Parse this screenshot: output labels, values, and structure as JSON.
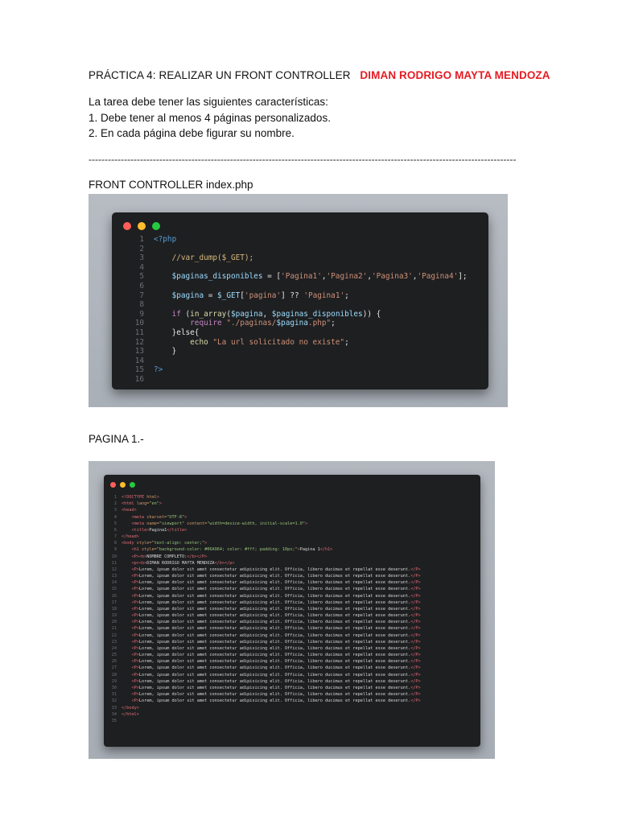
{
  "doc": {
    "title_prefix": "PRÁCTICA 4: REALIZAR UN FRONT CONTROLLER",
    "author": "DIMAN RODRIGO MAYTA MENDOZA",
    "task_lines": [
      "La tarea debe tener las siguientes características:",
      "1. Debe tener al menos 4 páginas personalizados.",
      "2. En cada página debe figurar su nombre."
    ],
    "divider": "-------------------------------------------------------------------------------------------------------------------------------------",
    "section1_label": "FRONT CONTROLLER index.php",
    "section2_label": "PAGINA 1.-"
  },
  "colors": {
    "author": "#e51c23",
    "editor_bg": "#1e1f21",
    "php_tag": "#569cd6",
    "comment": "#d7ba7d",
    "variable": "#9cdcfe",
    "string": "#ce9178",
    "keyword": "#c586c0",
    "function": "#dcdcaa",
    "html_tag": "#e06c75",
    "attr": "#d19a66",
    "attr_value": "#98c379"
  },
  "code1": {
    "lines": [
      [
        {
          "t": "<?php",
          "c": "php_tag"
        }
      ],
      [],
      [
        {
          "t": "    //var_dump($_GET);",
          "c": "comment"
        }
      ],
      [],
      [
        {
          "t": "    $paginas_disponibles",
          "c": "variable"
        },
        {
          "t": " = [",
          "c": "plain"
        },
        {
          "t": "'Pagina1'",
          "c": "string"
        },
        {
          "t": ",",
          "c": "plain"
        },
        {
          "t": "'Pagina2'",
          "c": "string"
        },
        {
          "t": ",",
          "c": "plain"
        },
        {
          "t": "'Pagina3'",
          "c": "string"
        },
        {
          "t": ",",
          "c": "plain"
        },
        {
          "t": "'Pagina4'",
          "c": "string"
        },
        {
          "t": "];",
          "c": "plain"
        }
      ],
      [],
      [
        {
          "t": "    $pagina",
          "c": "variable"
        },
        {
          "t": " = ",
          "c": "plain"
        },
        {
          "t": "$_GET",
          "c": "variable"
        },
        {
          "t": "[",
          "c": "plain"
        },
        {
          "t": "'pagina'",
          "c": "string"
        },
        {
          "t": "] ?? ",
          "c": "plain"
        },
        {
          "t": "'Pagina1'",
          "c": "string"
        },
        {
          "t": ";",
          "c": "plain"
        }
      ],
      [],
      [
        {
          "t": "    if ",
          "c": "keyword"
        },
        {
          "t": "(",
          "c": "plain"
        },
        {
          "t": "in_array",
          "c": "function"
        },
        {
          "t": "(",
          "c": "plain"
        },
        {
          "t": "$pagina",
          "c": "variable"
        },
        {
          "t": ", ",
          "c": "plain"
        },
        {
          "t": "$paginas_disponibles",
          "c": "variable"
        },
        {
          "t": ")) {",
          "c": "plain"
        }
      ],
      [
        {
          "t": "        require ",
          "c": "keyword"
        },
        {
          "t": "\"./paginas/",
          "c": "string"
        },
        {
          "t": "$pagina",
          "c": "variable"
        },
        {
          "t": ".php\"",
          "c": "string"
        },
        {
          "t": ";",
          "c": "plain"
        }
      ],
      [
        {
          "t": "    }else{",
          "c": "plain"
        }
      ],
      [
        {
          "t": "        echo ",
          "c": "function"
        },
        {
          "t": "\"La url solicitado no existe\"",
          "c": "string"
        },
        {
          "t": ";",
          "c": "plain"
        }
      ],
      [
        {
          "t": "    }",
          "c": "plain"
        }
      ],
      [],
      [
        {
          "t": "?>",
          "c": "php_tag"
        }
      ],
      []
    ]
  },
  "code2": {
    "lines": [
      [
        {
          "t": "<!DOCTYPE ",
          "c": "html_tag"
        },
        {
          "t": "html",
          "c": "attr"
        },
        {
          "t": ">",
          "c": "html_tag"
        }
      ],
      [
        {
          "t": "<html ",
          "c": "html_tag"
        },
        {
          "t": "lang=",
          "c": "attr"
        },
        {
          "t": "\"en\"",
          "c": "attr_value"
        },
        {
          "t": ">",
          "c": "html_tag"
        }
      ],
      [
        {
          "t": "<head>",
          "c": "html_tag"
        }
      ],
      [
        {
          "t": "    <meta ",
          "c": "html_tag"
        },
        {
          "t": "charset=",
          "c": "attr"
        },
        {
          "t": "\"UTF-8\"",
          "c": "attr_value"
        },
        {
          "t": ">",
          "c": "html_tag"
        }
      ],
      [
        {
          "t": "    <meta ",
          "c": "html_tag"
        },
        {
          "t": "name=",
          "c": "attr"
        },
        {
          "t": "\"viewport\" ",
          "c": "attr_value"
        },
        {
          "t": "content=",
          "c": "attr"
        },
        {
          "t": "\"width=device-width, initial-scale=1.0\"",
          "c": "attr_value"
        },
        {
          "t": ">",
          "c": "html_tag"
        }
      ],
      [
        {
          "t": "    <title>",
          "c": "html_tag"
        },
        {
          "t": "Pagina1",
          "c": "plain"
        },
        {
          "t": "</title>",
          "c": "html_tag"
        }
      ],
      [
        {
          "t": "</head>",
          "c": "html_tag"
        }
      ],
      [
        {
          "t": "<body ",
          "c": "html_tag"
        },
        {
          "t": "style=",
          "c": "attr"
        },
        {
          "t": "\"text-align: center;\"",
          "c": "attr_value"
        },
        {
          "t": ">",
          "c": "html_tag"
        }
      ],
      [
        {
          "t": "    <h1 ",
          "c": "html_tag"
        },
        {
          "t": "style=",
          "c": "attr"
        },
        {
          "t": "\"background-color: #06A964; color: #fff; padding: 10px;\"",
          "c": "attr_value"
        },
        {
          "t": ">",
          "c": "html_tag"
        },
        {
          "t": "Pagina 1",
          "c": "plain"
        },
        {
          "t": "</h1>",
          "c": "html_tag"
        }
      ],
      [
        {
          "t": "    <P><b>",
          "c": "html_tag"
        },
        {
          "t": "NOMBRE COMPLETO:",
          "c": "plain"
        },
        {
          "t": "</b></P>",
          "c": "html_tag"
        }
      ],
      [
        {
          "t": "    <p><b>",
          "c": "html_tag"
        },
        {
          "t": "DIMAN RODRIGO MAYTA MENDOZA",
          "c": "plain"
        },
        {
          "t": "</b></p>",
          "c": "html_tag"
        }
      ],
      [
        {
          "t": "    <P>",
          "c": "html_tag"
        },
        {
          "t": "Lorem, ipsum dolor sit amet consectetur adipisicing elit. Officia, libero ducimus et repellat esse deserunt.",
          "c": "plain"
        },
        {
          "t": "</P>",
          "c": "html_tag"
        }
      ],
      [
        {
          "t": "    <P>",
          "c": "html_tag"
        },
        {
          "t": "Lorem, ipsum dolor sit amet consectetur adipisicing elit. Officia, libero ducimus et repellat esse deserunt.",
          "c": "plain"
        },
        {
          "t": "</P>",
          "c": "html_tag"
        }
      ],
      [
        {
          "t": "    <P>",
          "c": "html_tag"
        },
        {
          "t": "Lorem, ipsum dolor sit amet consectetur adipisicing elit. Officia, libero ducimus et repellat esse deserunt.",
          "c": "plain"
        },
        {
          "t": "</P>",
          "c": "html_tag"
        }
      ],
      [
        {
          "t": "    <P>",
          "c": "html_tag"
        },
        {
          "t": "Lorem, ipsum dolor sit amet consectetur adipisicing elit. Officia, libero ducimus et repellat esse deserunt.",
          "c": "plain"
        },
        {
          "t": "</P>",
          "c": "html_tag"
        }
      ],
      [
        {
          "t": "    <P>",
          "c": "html_tag"
        },
        {
          "t": "Lorem, ipsum dolor sit amet consectetur adipisicing elit. Officia, libero ducimus et repellat esse deserunt.",
          "c": "plain"
        },
        {
          "t": "</P>",
          "c": "html_tag"
        }
      ],
      [
        {
          "t": "    <P>",
          "c": "html_tag"
        },
        {
          "t": "Lorem, ipsum dolor sit amet consectetur adipisicing elit. Officia, libero ducimus et repellat esse deserunt.",
          "c": "plain"
        },
        {
          "t": "</P>",
          "c": "html_tag"
        }
      ],
      [
        {
          "t": "    <P>",
          "c": "html_tag"
        },
        {
          "t": "Lorem, ipsum dolor sit amet consectetur adipisicing elit. Officia, libero ducimus et repellat esse deserunt.",
          "c": "plain"
        },
        {
          "t": "</P>",
          "c": "html_tag"
        }
      ],
      [
        {
          "t": "    <P>",
          "c": "html_tag"
        },
        {
          "t": "Lorem, ipsum dolor sit amet consectetur adipisicing elit. Officia, libero ducimus et repellat esse deserunt.",
          "c": "plain"
        },
        {
          "t": "</P>",
          "c": "html_tag"
        }
      ],
      [
        {
          "t": "    <P>",
          "c": "html_tag"
        },
        {
          "t": "Lorem, ipsum dolor sit amet consectetur adipisicing elit. Officia, libero ducimus et repellat esse deserunt.",
          "c": "plain"
        },
        {
          "t": "</P>",
          "c": "html_tag"
        }
      ],
      [
        {
          "t": "    <P>",
          "c": "html_tag"
        },
        {
          "t": "Lorem, ipsum dolor sit amet consectetur adipisicing elit. Officia, libero ducimus et repellat esse deserunt.",
          "c": "plain"
        },
        {
          "t": "</P>",
          "c": "html_tag"
        }
      ],
      [
        {
          "t": "    <P>",
          "c": "html_tag"
        },
        {
          "t": "Lorem, ipsum dolor sit amet consectetur adipisicing elit. Officia, libero ducimus et repellat esse deserunt.",
          "c": "plain"
        },
        {
          "t": "</P>",
          "c": "html_tag"
        }
      ],
      [
        {
          "t": "    <P>",
          "c": "html_tag"
        },
        {
          "t": "Lorem, ipsum dolor sit amet consectetur adipisicing elit. Officia, libero ducimus et repellat esse deserunt.",
          "c": "plain"
        },
        {
          "t": "</P>",
          "c": "html_tag"
        }
      ],
      [
        {
          "t": "    <P>",
          "c": "html_tag"
        },
        {
          "t": "Lorem, ipsum dolor sit amet consectetur adipisicing elit. Officia, libero ducimus et repellat esse deserunt.",
          "c": "plain"
        },
        {
          "t": "</P>",
          "c": "html_tag"
        }
      ],
      [
        {
          "t": "    <P>",
          "c": "html_tag"
        },
        {
          "t": "Lorem, ipsum dolor sit amet consectetur adipisicing elit. Officia, libero ducimus et repellat esse deserunt.",
          "c": "plain"
        },
        {
          "t": "</P>",
          "c": "html_tag"
        }
      ],
      [
        {
          "t": "    <P>",
          "c": "html_tag"
        },
        {
          "t": "Lorem, ipsum dolor sit amet consectetur adipisicing elit. Officia, libero ducimus et repellat esse deserunt.",
          "c": "plain"
        },
        {
          "t": "</P>",
          "c": "html_tag"
        }
      ],
      [
        {
          "t": "    <P>",
          "c": "html_tag"
        },
        {
          "t": "Lorem, ipsum dolor sit amet consectetur adipisicing elit. Officia, libero ducimus et repellat esse deserunt.",
          "c": "plain"
        },
        {
          "t": "</P>",
          "c": "html_tag"
        }
      ],
      [
        {
          "t": "    <P>",
          "c": "html_tag"
        },
        {
          "t": "Lorem, ipsum dolor sit amet consectetur adipisicing elit. Officia, libero ducimus et repellat esse deserunt.",
          "c": "plain"
        },
        {
          "t": "</P>",
          "c": "html_tag"
        }
      ],
      [
        {
          "t": "    <P>",
          "c": "html_tag"
        },
        {
          "t": "Lorem, ipsum dolor sit amet consectetur adipisicing elit. Officia, libero ducimus et repellat esse deserunt.",
          "c": "plain"
        },
        {
          "t": "</P>",
          "c": "html_tag"
        }
      ],
      [
        {
          "t": "    <P>",
          "c": "html_tag"
        },
        {
          "t": "Lorem, ipsum dolor sit amet consectetur adipisicing elit. Officia, libero ducimus et repellat esse deserunt.",
          "c": "plain"
        },
        {
          "t": "</P>",
          "c": "html_tag"
        }
      ],
      [
        {
          "t": "    <P>",
          "c": "html_tag"
        },
        {
          "t": "Lorem, ipsum dolor sit amet consectetur adipisicing elit. Officia, libero ducimus et repellat esse deserunt.",
          "c": "plain"
        },
        {
          "t": "</P>",
          "c": "html_tag"
        }
      ],
      [
        {
          "t": "    <P>",
          "c": "html_tag"
        },
        {
          "t": "Lorem, ipsum dolor sit amet consectetur adipisicing elit. Officia, libero ducimus et repellat esse deserunt.",
          "c": "plain"
        },
        {
          "t": "</P>",
          "c": "html_tag"
        }
      ],
      [
        {
          "t": "</body>",
          "c": "html_tag"
        }
      ],
      [
        {
          "t": "</html>",
          "c": "html_tag"
        }
      ],
      []
    ]
  }
}
